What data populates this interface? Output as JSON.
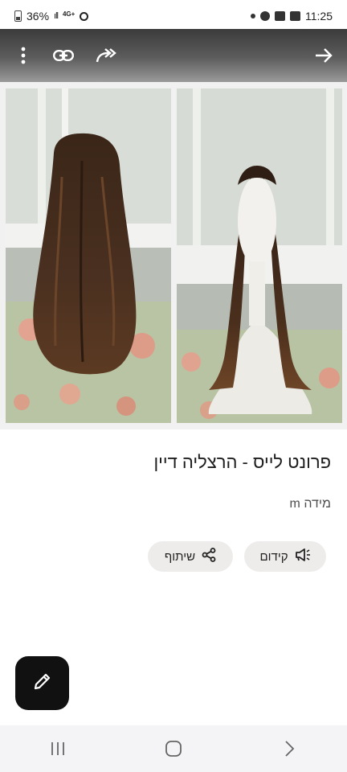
{
  "status_bar": {
    "battery": "36%",
    "network": "4G+",
    "time": "11:25"
  },
  "toolbar": {
    "icons": [
      "more-vert-icon",
      "link-icon",
      "forward-all-icon",
      "arrow-right-icon"
    ]
  },
  "post": {
    "title": "פרונט לייס - הרצליה דיין",
    "size": "מידה m",
    "actions": {
      "promote_label": "קידום",
      "share_label": "שיתוף"
    }
  },
  "fab": {
    "icon": "edit-pencil-icon"
  },
  "nav": {
    "icons": [
      "recent-apps-icon",
      "home-icon",
      "back-icon"
    ]
  },
  "colors": {
    "toolbar": "#4a4a4a",
    "chip_bg": "#eeeceb",
    "fab_bg": "#111111"
  }
}
